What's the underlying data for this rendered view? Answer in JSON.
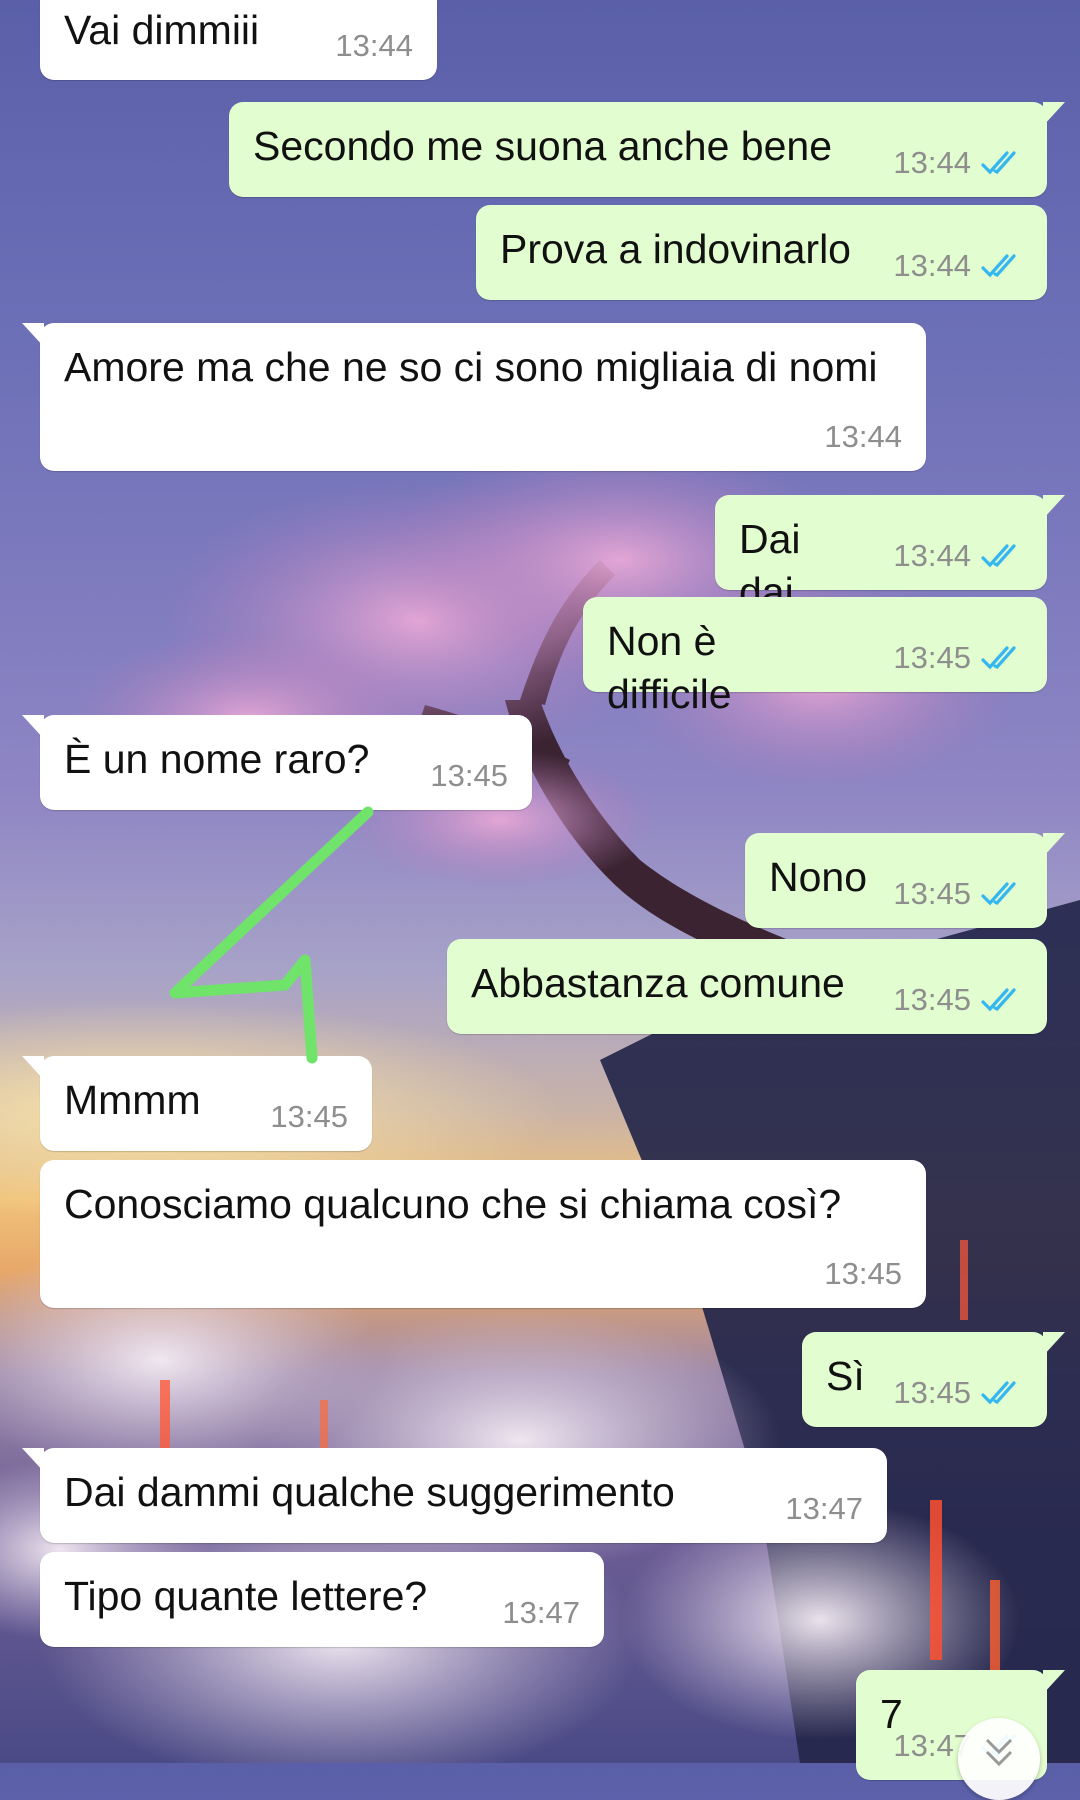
{
  "chat": {
    "messages": [
      {
        "dir": "in",
        "text": "Vai dimmiii",
        "time": "13:44"
      },
      {
        "dir": "out",
        "text": "Secondo me suona anche bene",
        "time": "13:44",
        "status": "read"
      },
      {
        "dir": "out",
        "text": "Prova a indovinarlo",
        "time": "13:44",
        "status": "read"
      },
      {
        "dir": "in",
        "text": "Amore ma che ne so ci sono migliaia di nomi",
        "time": "13:44"
      },
      {
        "dir": "out",
        "text": "Dai dai",
        "time": "13:44",
        "status": "read"
      },
      {
        "dir": "out",
        "text": "Non è difficile",
        "time": "13:45",
        "status": "read"
      },
      {
        "dir": "in",
        "text": "È un nome raro?",
        "time": "13:45"
      },
      {
        "dir": "out",
        "text": "Nono",
        "time": "13:45",
        "status": "read"
      },
      {
        "dir": "out",
        "text": "Abbastanza comune",
        "time": "13:45",
        "status": "read"
      },
      {
        "dir": "in",
        "text": "Mmmm",
        "time": "13:45"
      },
      {
        "dir": "in",
        "text": "Conosciamo qualcuno che si chiama così?",
        "time": "13:45"
      },
      {
        "dir": "out",
        "text": "Sì",
        "time": "13:45",
        "status": "read"
      },
      {
        "dir": "in",
        "text": "Dai dammi qualche suggerimento",
        "time": "13:47"
      },
      {
        "dir": "in",
        "text": "Tipo quante lettere?",
        "time": "13:47"
      },
      {
        "dir": "out",
        "text": "7",
        "time": "13:47",
        "status": "read"
      }
    ]
  },
  "colors": {
    "incoming_bubble": "#ffffff",
    "outgoing_bubble": "#e2fdcf",
    "read_ticks": "#34b7f1",
    "annotation_arrow": "#6fe36a"
  },
  "icons": {
    "read_status": "double-check-icon",
    "scroll": "chevron-down-icon"
  }
}
